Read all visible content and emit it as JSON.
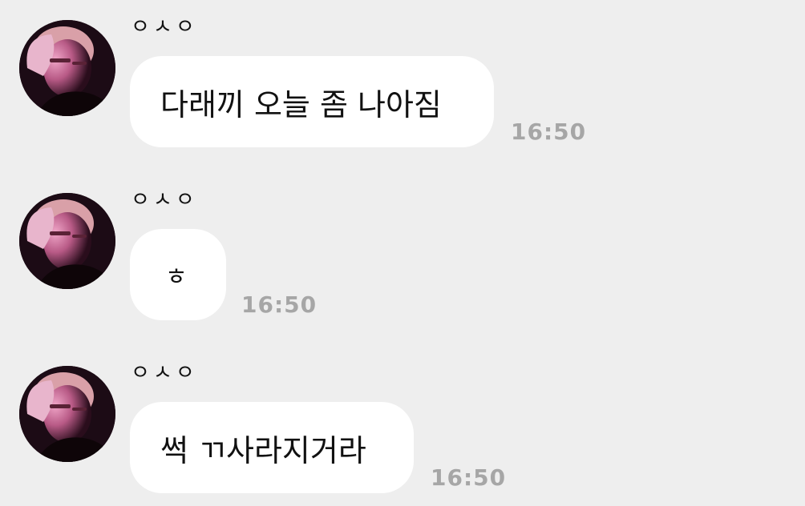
{
  "messages": [
    {
      "sender": "ㅇㅅㅇ",
      "text": "다래끼 오늘 좀 나아짐",
      "time": "16:50"
    },
    {
      "sender": "ㅇㅅㅇ",
      "text": "ㅎ",
      "time": "16:50"
    },
    {
      "sender": "ㅇㅅㅇ",
      "text": "썩 ㄲ사라지거라",
      "time": "16:50"
    }
  ]
}
